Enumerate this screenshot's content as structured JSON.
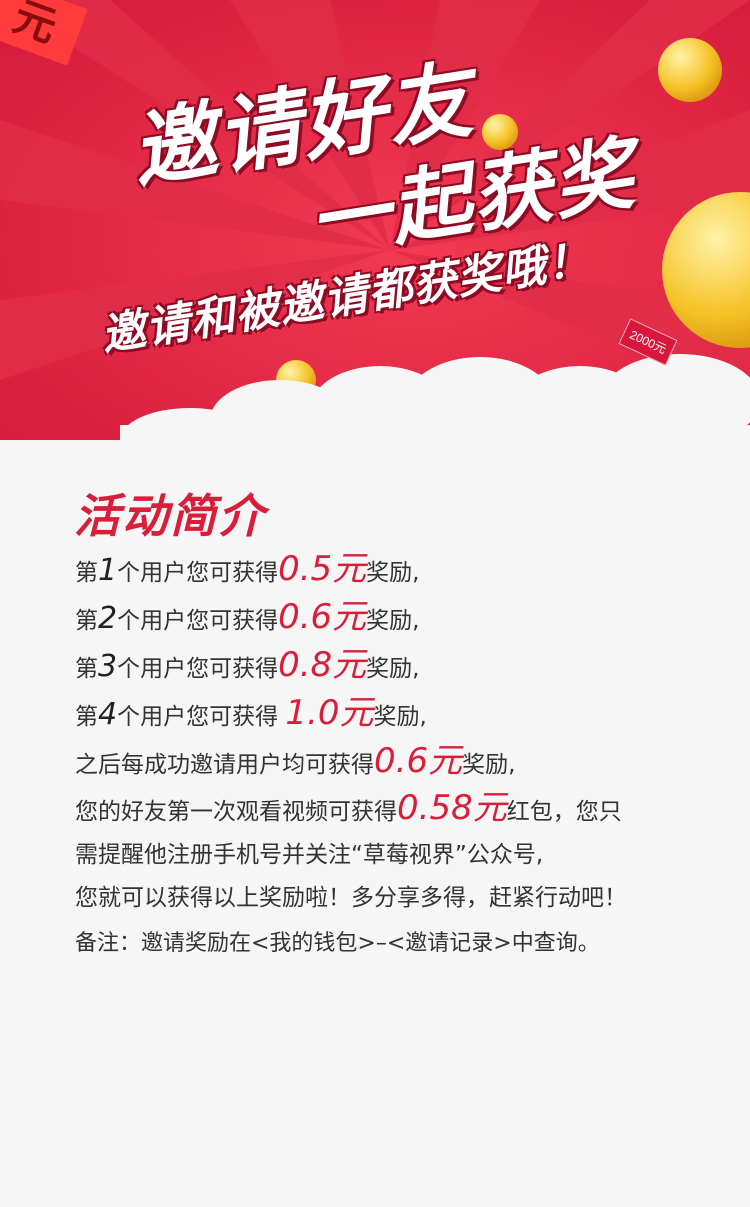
{
  "banner": {
    "title_line1": "邀请好友",
    "title_line2": "一起获奖",
    "subtitle": "邀请和被邀请都获奖哦！",
    "tag": "2000元",
    "corner_tag": "元",
    "colors": {
      "red": "#e8203f",
      "ray": "#d4183a",
      "gold": "#f5c327"
    }
  },
  "section": {
    "title": "活动简介",
    "rewards": [
      {
        "prefix": "第",
        "num": "1",
        "middle": "个用户您可获得",
        "amount": "0.5元",
        "suffix": "奖励,"
      },
      {
        "prefix": "第",
        "num": "2",
        "middle": "个用户您可获得",
        "amount": "0.6元",
        "suffix": "奖励,"
      },
      {
        "prefix": "第",
        "num": "3",
        "middle": "个用户您可获得",
        "amount": "0.8元",
        "suffix": "奖励,"
      },
      {
        "prefix": "第",
        "num": "4",
        "middle": "个用户您可获得 ",
        "amount": "1.0元",
        "suffix": "奖励,"
      }
    ],
    "after": {
      "text": "之后每成功邀请用户均可获得",
      "amount": "0.6元",
      "suffix": "奖励,"
    },
    "friend": {
      "text": "您的好友第一次观看视频可获得",
      "amount": "0.58元",
      "suffix": "红包，您只",
      "line2": "需提醒他注册手机号并关注“草莓视界”公众号,",
      "line3": "您就可以获得以上奖励啦！多分享多得，赶紧行动吧！"
    },
    "note": "备注：邀请奖励在<我的钱包>–<邀请记录>中查询。"
  }
}
